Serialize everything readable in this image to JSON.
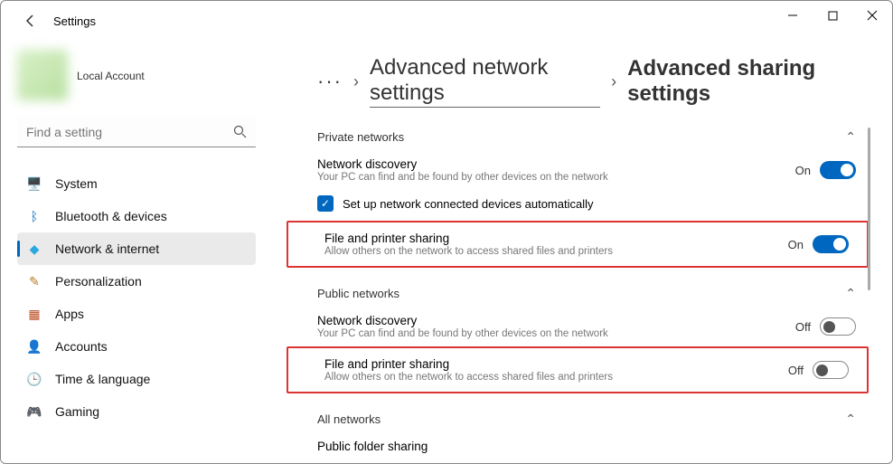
{
  "window": {
    "title": "Settings",
    "controls": {
      "min": "—",
      "max": "▢",
      "close": "✕"
    }
  },
  "profile": {
    "name": "",
    "subtitle": "Local Account"
  },
  "search": {
    "placeholder": "Find a setting"
  },
  "nav": [
    {
      "icon": "🖥️",
      "label": "System",
      "color": "#3a8ee6"
    },
    {
      "icon": "ᛒ",
      "label": "Bluetooth & devices",
      "color": "#0067c0"
    },
    {
      "icon": "◆",
      "label": "Network & internet",
      "color": "#2aa9e0",
      "active": true
    },
    {
      "icon": "✎",
      "label": "Personalization",
      "color": "#b97a20"
    },
    {
      "icon": "▦",
      "label": "Apps",
      "color": "#b94a20"
    },
    {
      "icon": "👤",
      "label": "Accounts",
      "color": "#5aa84a"
    },
    {
      "icon": "🕒",
      "label": "Time & language",
      "color": "#666"
    },
    {
      "icon": "🎮",
      "label": "Gaming",
      "color": "#666"
    }
  ],
  "breadcrumb": {
    "dots": "···",
    "seg1": "Advanced network settings",
    "seg2": "Advanced sharing settings"
  },
  "sections": {
    "private": {
      "title": "Private networks",
      "discovery": {
        "title": "Network discovery",
        "sub": "Your PC can find and be found by other devices on the network",
        "state": "On",
        "on": true
      },
      "auto_checkbox": {
        "label": "Set up network connected devices automatically",
        "checked": true
      },
      "fileprint": {
        "title": "File and printer sharing",
        "sub": "Allow others on the network to access shared files and printers",
        "state": "On",
        "on": true
      }
    },
    "public": {
      "title": "Public networks",
      "discovery": {
        "title": "Network discovery",
        "sub": "Your PC can find and be found by other devices on the network",
        "state": "Off",
        "on": false
      },
      "fileprint": {
        "title": "File and printer sharing",
        "sub": "Allow others on the network to access shared files and printers",
        "state": "Off",
        "on": false
      }
    },
    "all": {
      "title": "All networks",
      "folder": {
        "title": "Public folder sharing"
      }
    }
  }
}
